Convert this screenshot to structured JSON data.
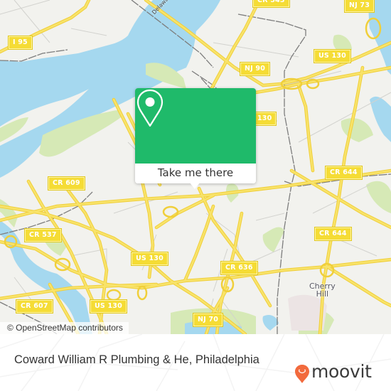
{
  "map": {
    "colors": {
      "land": "#f2f2ee",
      "water": "#a5d8ef",
      "park": "#d6e9b6",
      "road_major": "#f5dc52",
      "road_minor": "#d0d0cc",
      "rail": "#7a7a7a"
    },
    "road_shields": [
      {
        "id": "i95",
        "label": "I 95"
      },
      {
        "id": "cr543",
        "label": "CR 543"
      },
      {
        "id": "nj73",
        "label": "NJ 73"
      },
      {
        "id": "us130-ne",
        "label": "US 130"
      },
      {
        "id": "nj90",
        "label": "NJ 90"
      },
      {
        "id": "us130-n",
        "label": "130"
      },
      {
        "id": "cr644-n",
        "label": "CR 644"
      },
      {
        "id": "cr609",
        "label": "CR 609"
      },
      {
        "id": "cr537",
        "label": "CR 537"
      },
      {
        "id": "cr644-e",
        "label": "CR 644"
      },
      {
        "id": "us130-c",
        "label": "US 130"
      },
      {
        "id": "cr636",
        "label": "CR 636"
      },
      {
        "id": "cr607",
        "label": "CR 607"
      },
      {
        "id": "us130-s",
        "label": "US 130"
      },
      {
        "id": "nj70",
        "label": "NJ 70"
      }
    ],
    "place_labels": {
      "cherry_hill_line1": "Cherry",
      "cherry_hill_line2": "Hill",
      "river": "Delaware River"
    },
    "attribution": "© OpenStreetMap contributors"
  },
  "popup": {
    "icon": "map-pin-icon",
    "accent_color": "#1fba6a",
    "button_label": "Take me there"
  },
  "footer": {
    "title": "Coward William R Plumbing & He, Philadelphia",
    "brand_name": "moovit",
    "brand_color": "#f26a3d",
    "brand_icon": "moovit-smiley-pin-icon"
  }
}
